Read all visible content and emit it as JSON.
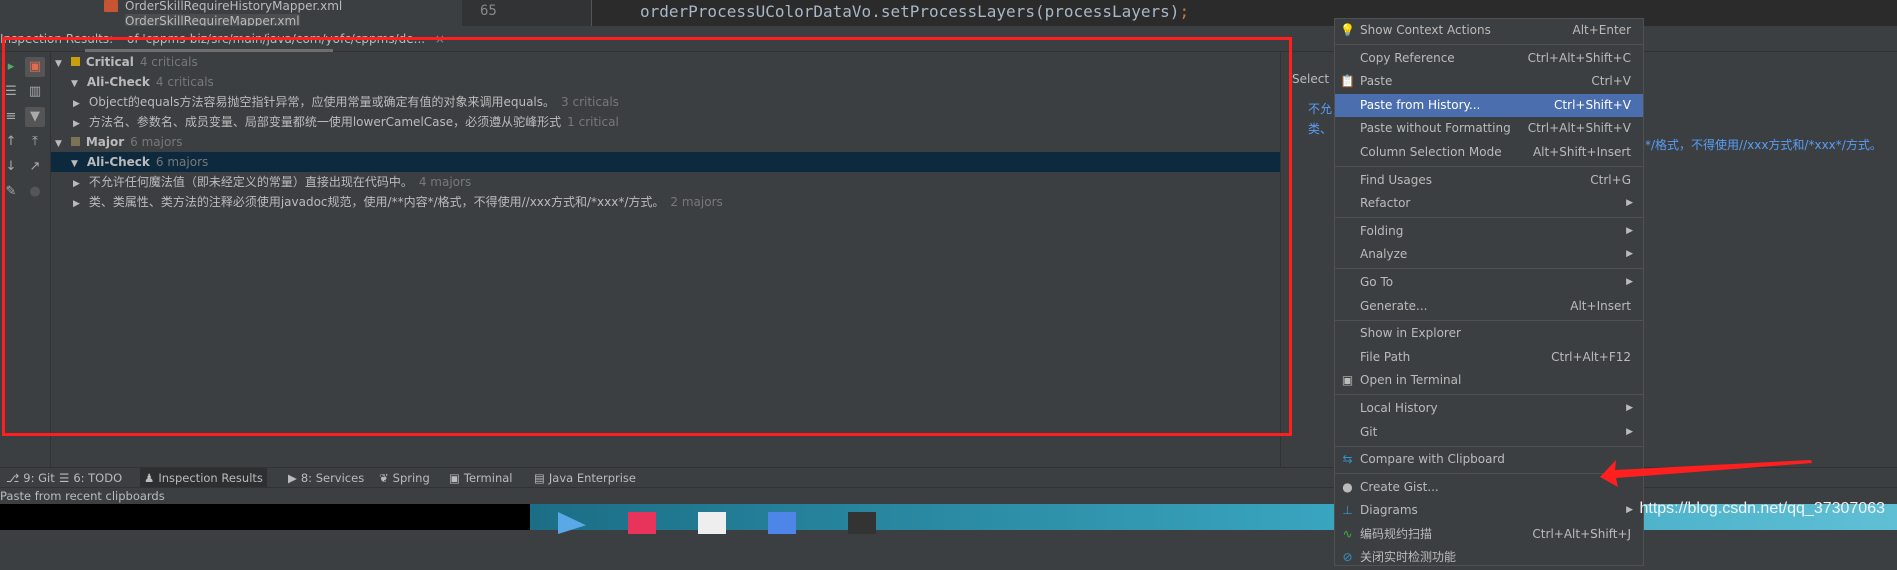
{
  "editor": {
    "project_files": [
      "OrderSkillRequireHistoryMapper.xml",
      "OrderSkillRequireMapper.xml"
    ],
    "line_number": "65",
    "code_line": "orderProcessUColorDataVo.setProcessLayers(processLayers)",
    "code_semicolon": ";"
  },
  "inspection_tab": {
    "title": "Inspection Results:",
    "scope": "of 'cppms-biz/src/main/java/com/yofc/cppms/de...",
    "close_icon": "×"
  },
  "tree": {
    "groups": [
      {
        "label": "Critical",
        "count": "4 criticals",
        "color": "#c8a00a",
        "sub": {
          "label": "Ali-Check",
          "count": "4 criticals"
        },
        "items": [
          {
            "label": "Object的equals方法容易抛空指针异常，应使用常量或确定有值的对象来调用equals。",
            "count": "3 criticals"
          },
          {
            "label": "方法名、参数名、成员变量、局部变量都统一使用lowerCamelCase，必须遵从驼峰形式",
            "count": "1 critical"
          }
        ]
      },
      {
        "label": "Major",
        "count": "6 majors",
        "color": "#7a7355",
        "sub": {
          "label": "Ali-Check",
          "count": "6 majors"
        },
        "items": [
          {
            "label": "不允许任何魔法值（即未经定义的常量）直接出现在代码中。",
            "count": "4 majors"
          },
          {
            "label": "类、类属性、类方法的注释必须使用javadoc规范，使用/**内容*/格式，不得使用//xxx方式和/*xxx*/方式。",
            "count": "2 majors"
          }
        ]
      }
    ]
  },
  "right_panel": {
    "select_text": "Select i",
    "line1": "不允",
    "line2": "类、",
    "line2_tail": "*/格式，不得使用//xxx方式和/*xxx*/方式。"
  },
  "context_menu": {
    "items": [
      {
        "label": "Show Context Actions",
        "shortcut": "Alt+Enter",
        "icon": "lightbulb-icon",
        "glyph": "💡"
      },
      {
        "sep": true
      },
      {
        "label": "Copy Reference",
        "shortcut": "Ctrl+Alt+Shift+C"
      },
      {
        "label": "Paste",
        "shortcut": "Ctrl+V",
        "icon": "clipboard-icon",
        "glyph": "📋"
      },
      {
        "label": "Paste from History...",
        "shortcut": "Ctrl+Shift+V",
        "highlighted": true
      },
      {
        "label": "Paste without Formatting",
        "shortcut": "Ctrl+Alt+Shift+V"
      },
      {
        "label": "Column Selection Mode",
        "shortcut": "Alt+Shift+Insert"
      },
      {
        "sep": true
      },
      {
        "label": "Find Usages",
        "shortcut": "Ctrl+G"
      },
      {
        "label": "Refactor",
        "submenu": true
      },
      {
        "sep": true
      },
      {
        "label": "Folding",
        "submenu": true
      },
      {
        "label": "Analyze",
        "submenu": true
      },
      {
        "sep": true
      },
      {
        "label": "Go To",
        "submenu": true
      },
      {
        "label": "Generate...",
        "shortcut": "Alt+Insert"
      },
      {
        "sep": true
      },
      {
        "label": "Show in Explorer"
      },
      {
        "label": "File Path",
        "shortcut": "Ctrl+Alt+F12"
      },
      {
        "label": "Open in Terminal",
        "icon": "terminal-icon",
        "glyph": "▣"
      },
      {
        "sep": true
      },
      {
        "label": "Local History",
        "submenu": true
      },
      {
        "label": "Git",
        "submenu": true
      },
      {
        "sep": true
      },
      {
        "label": "Compare with Clipboard",
        "icon": "compare-clipboard-icon",
        "glyph": "⇆"
      },
      {
        "sep": true
      },
      {
        "label": "Create Gist...",
        "icon": "github-icon",
        "glyph": "●"
      },
      {
        "label": "Diagrams",
        "submenu": true,
        "icon": "diagrams-icon",
        "glyph": "⊥"
      },
      {
        "label": "编码规约扫描",
        "shortcut": "Ctrl+Alt+Shift+J",
        "icon": "scan-icon",
        "glyph": "∿"
      },
      {
        "label": "关闭实时检测功能",
        "icon": "disable-icon",
        "glyph": "⊘"
      }
    ]
  },
  "tool_windows": [
    {
      "label": "9: Git",
      "icon": "git-icon",
      "glyph": "⎇"
    },
    {
      "label": "6: TODO",
      "icon": "todo-icon",
      "glyph": "☰"
    },
    {
      "label": "Inspection Results",
      "icon": "inspection-icon",
      "glyph": "♟",
      "active": true
    },
    {
      "label": "8: Services",
      "icon": "services-icon",
      "glyph": "▶"
    },
    {
      "label": "Spring",
      "icon": "spring-icon",
      "glyph": "❦"
    },
    {
      "label": "Terminal",
      "icon": "terminal-icon",
      "glyph": "▣"
    },
    {
      "label": "Java Enterprise",
      "icon": "java-enterprise-icon",
      "glyph": "▤"
    }
  ],
  "status_text": "Paste from recent clipboards",
  "watermark": "https://blog.csdn.net/qq_37307063",
  "colors": {
    "highlight": "#4b6eaf",
    "selection": "#0d293e",
    "annotation": "#ff1f1f",
    "link": "#589df6"
  }
}
